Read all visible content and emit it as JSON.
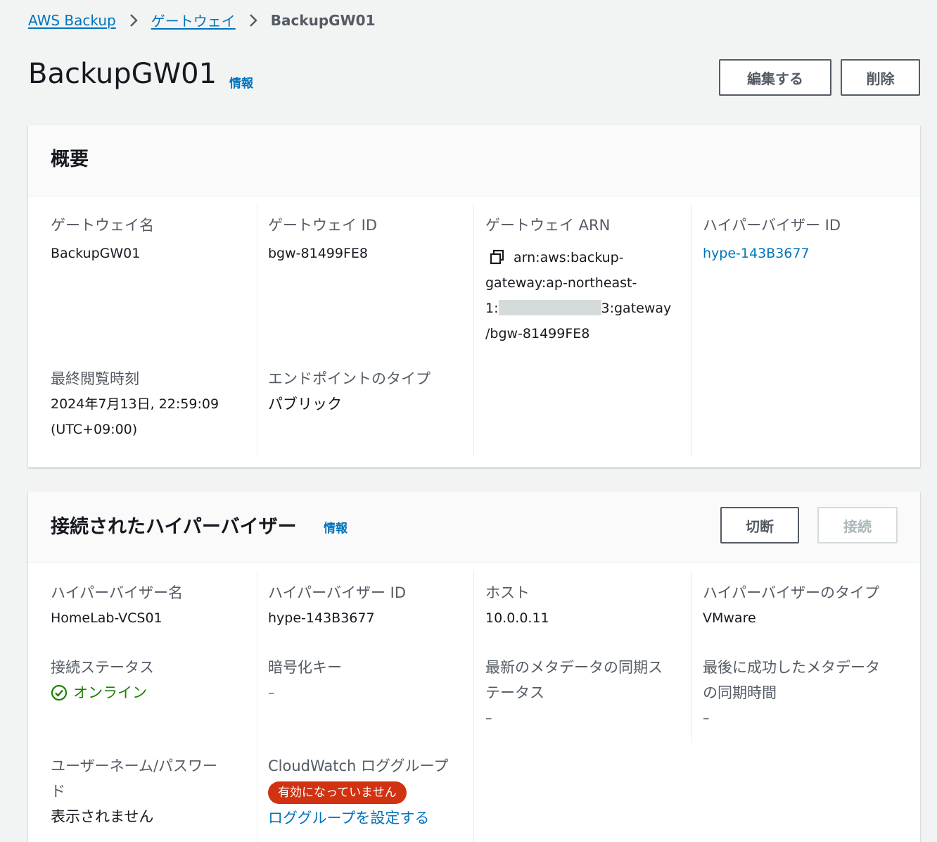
{
  "breadcrumb": {
    "items": [
      "AWS Backup",
      "ゲートウェイ"
    ],
    "current": "BackupGW01"
  },
  "header": {
    "title": "BackupGW01",
    "info": "情報",
    "edit_label": "編集する",
    "delete_label": "削除"
  },
  "overview": {
    "title": "概要",
    "gateway_name_label": "ゲートウェイ名",
    "gateway_name": "BackupGW01",
    "gateway_id_label": "ゲートウェイ ID",
    "gateway_id": "bgw-81499FE8",
    "gateway_arn_label": "ゲートウェイ ARN",
    "arn_line1": "arn:aws:backup-",
    "arn_line2": "gateway:ap-northeast-",
    "arn_line3_prefix": "1:",
    "arn_line3_suffix": "3:gateway",
    "arn_line4": "/bgw-81499FE8",
    "hypervisor_id_label": "ハイパーバイザー ID",
    "hypervisor_id": "hype-143B3677",
    "last_seen_label": "最終閲覧時刻",
    "last_seen_line1": "2024年7月13日, 22:59:09",
    "last_seen_line2": "(UTC+09:00)",
    "endpoint_type_label": "エンドポイントのタイプ",
    "endpoint_type": "パブリック"
  },
  "hypervisor": {
    "title": "接続されたハイパーバイザー",
    "info": "情報",
    "disconnect_label": "切断",
    "connect_label": "接続",
    "name_label": "ハイパーバイザー名",
    "name": "HomeLab-VCS01",
    "id_label": "ハイパーバイザー ID",
    "id": "hype-143B3677",
    "host_label": "ホスト",
    "host": "10.0.0.11",
    "type_label": "ハイパーバイザーのタイプ",
    "type": "VMware",
    "connection_status_label": "接続ステータス",
    "connection_status": "オンライン",
    "encryption_key_label": "暗号化キー",
    "encryption_key": "–",
    "latest_sync_status_label_1": "最新のメタデータの同期ス",
    "latest_sync_status_label_2": "テータス",
    "latest_sync_status": "–",
    "last_success_sync_label_1": "最後に成功したメタデータ",
    "last_success_sync_label_2": "の同期時間",
    "last_success_sync": "–",
    "credentials_label_1": "ユーザーネーム/パスワー",
    "credentials_label_2": "ド",
    "credentials": "表示されません",
    "log_group_label": "CloudWatch ロググループ",
    "log_group_status": "有効になっていません",
    "log_group_link": "ロググループを設定する"
  },
  "colors": {
    "link": "#0073bb",
    "success": "#1d8102",
    "error": "#d13212",
    "background": "#f2f3f3"
  }
}
